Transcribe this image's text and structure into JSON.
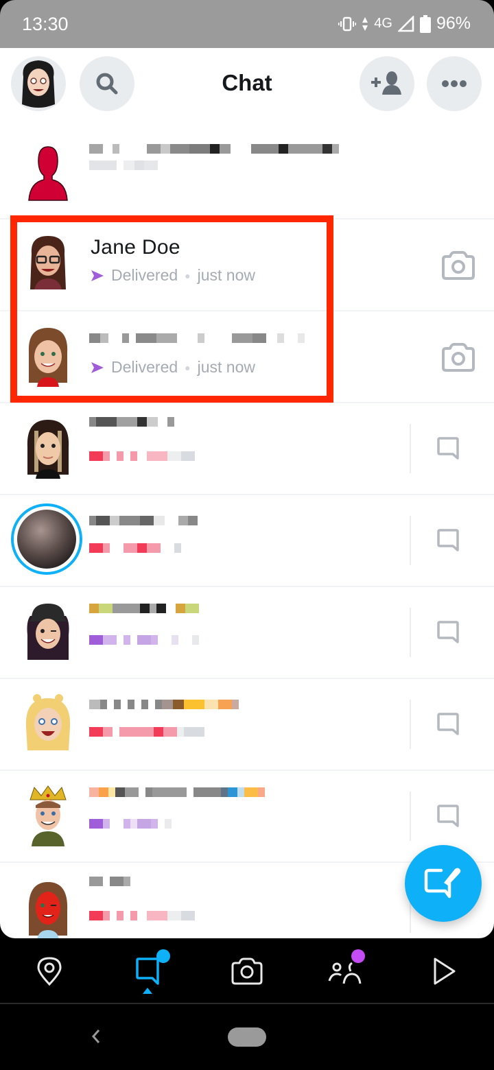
{
  "status_bar": {
    "time": "13:30",
    "network": "4G",
    "battery": "96%",
    "icons": [
      "vibrate-icon",
      "data-arrows-icon",
      "signal-icon",
      "battery-icon"
    ]
  },
  "header": {
    "title": "Chat",
    "buttons": [
      "profile-avatar",
      "search-icon",
      "add-friend-icon",
      "more-icon"
    ]
  },
  "chats": [
    {
      "name": "",
      "name_redacted": true,
      "status": "",
      "status_redacted": true,
      "avatar": "default-red-silhouette",
      "action": "none"
    },
    {
      "name": "Jane Doe",
      "status": "Delivered",
      "time": "just now",
      "status_color": "#a05dd9",
      "avatar": "bitmoji-glasses-brunette",
      "action": "camera"
    },
    {
      "name": "",
      "name_redacted": true,
      "status": "Delivered",
      "time": "just now",
      "status_color": "#a05dd9",
      "avatar": "bitmoji-long-brown-hair",
      "action": "camera"
    },
    {
      "name": "",
      "name_redacted": true,
      "status_redacted": true,
      "status_color": "#f23c57",
      "avatar": "bitmoji-highlighted-hair",
      "action": "chat"
    },
    {
      "name": "",
      "name_redacted": true,
      "status_redacted": true,
      "status_color": "#f23c57",
      "avatar": "story-photo-ring",
      "action": "chat"
    },
    {
      "name": "",
      "name_redacted": true,
      "status_redacted": true,
      "status_color": "#a05dd9",
      "avatar": "bitmoji-beanie-wink",
      "action": "chat"
    },
    {
      "name": "",
      "name_redacted": true,
      "status_redacted": true,
      "status_color": "#f23c57",
      "avatar": "bitmoji-blonde-buns",
      "action": "chat"
    },
    {
      "name": "",
      "name_redacted": true,
      "status_redacted": true,
      "status_color": "#a05dd9",
      "avatar": "bitmoji-crown",
      "action": "chat"
    },
    {
      "name": "",
      "name_redacted": true,
      "status_redacted": true,
      "status_color": "#f23c57",
      "avatar": "bitmoji-red-face",
      "action": "chat"
    }
  ],
  "highlight": {
    "color": "#ff2600",
    "rows": [
      "Jane Doe",
      "redacted contact"
    ]
  },
  "fab": {
    "label": "New Chat",
    "icon": "new-chat-icon",
    "color": "#0eb1f7"
  },
  "bottom_nav": {
    "items": [
      {
        "id": "map",
        "icon": "map-pin-icon",
        "active": false
      },
      {
        "id": "chat",
        "icon": "chat-icon",
        "active": true,
        "badge_color": "#0eb1f7"
      },
      {
        "id": "camera",
        "icon": "camera-icon",
        "active": false
      },
      {
        "id": "stories",
        "icon": "friends-icon",
        "active": false,
        "badge_color": "#c44cf5"
      },
      {
        "id": "spotlight",
        "icon": "play-icon",
        "active": false
      }
    ]
  },
  "colors": {
    "accent": "#0eb1f7",
    "delivered_arrow": "#a05dd9",
    "secondary_text": "#a5abb3"
  }
}
